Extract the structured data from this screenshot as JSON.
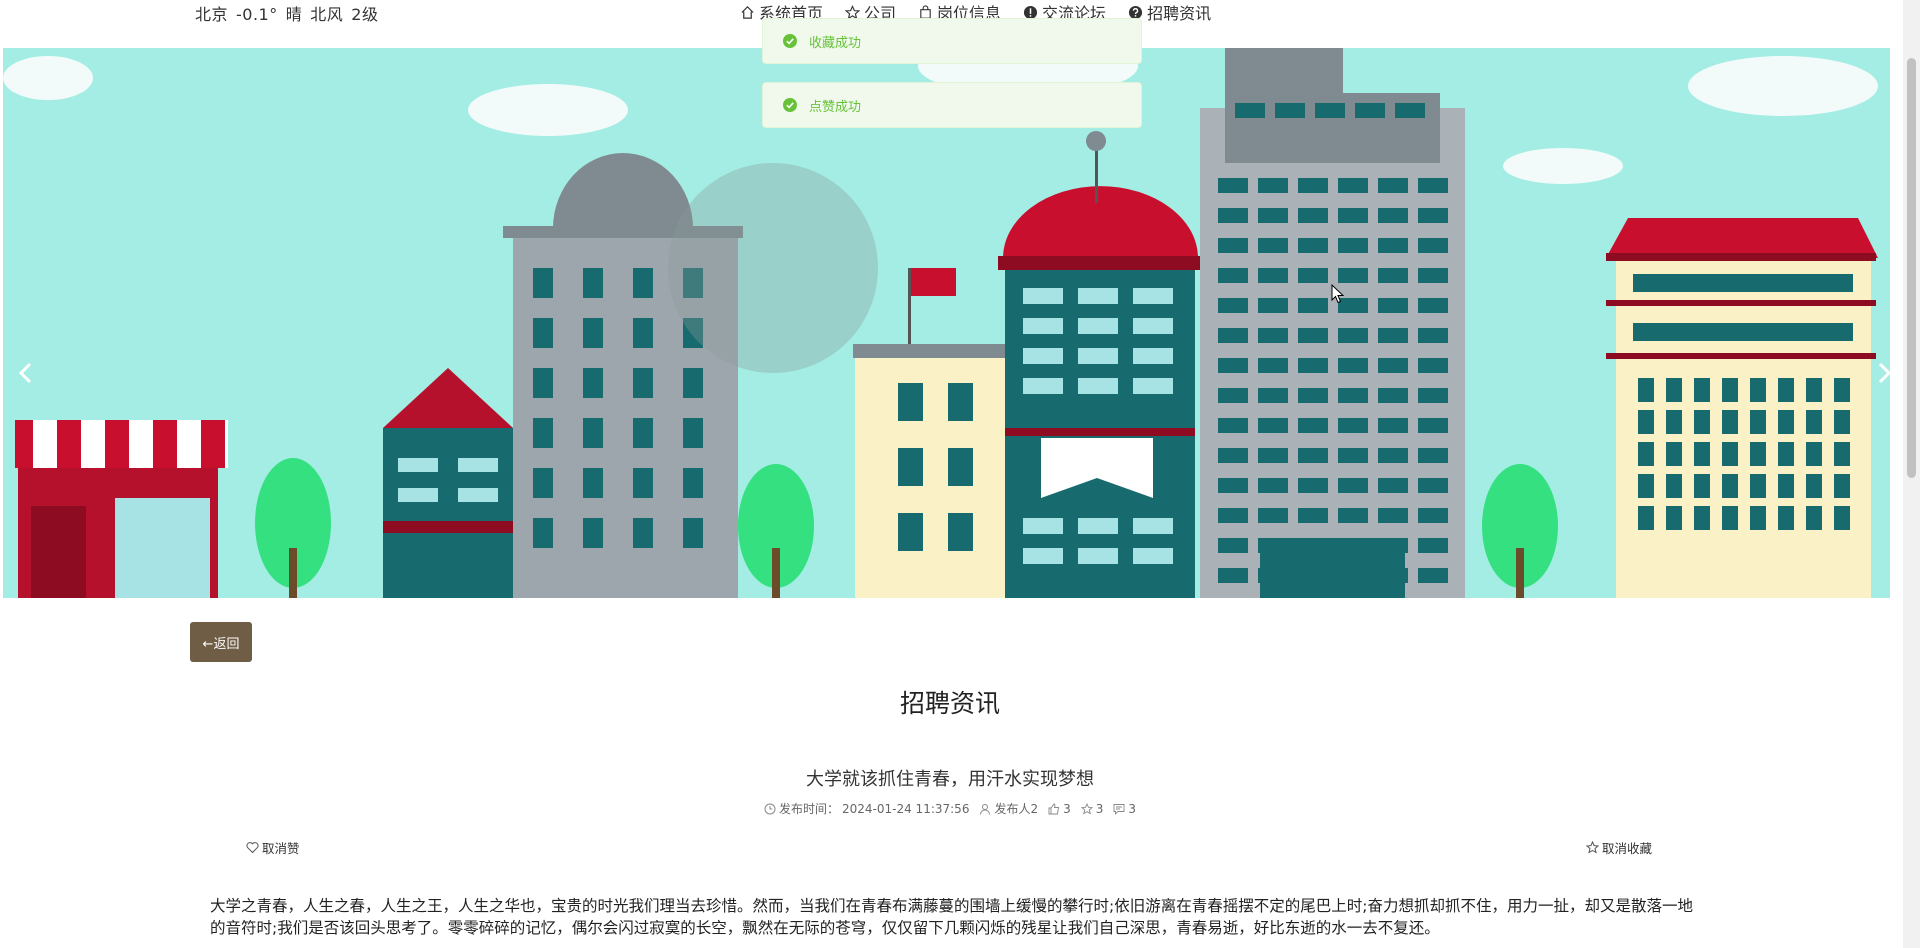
{
  "weather": {
    "city": "北京",
    "temp": "-0.1°",
    "condition": "晴",
    "wind": "北风",
    "level": "2级"
  },
  "nav": [
    {
      "label": "系统首页",
      "icon": "home-icon"
    },
    {
      "label": "公司",
      "icon": "star-icon"
    },
    {
      "label": "岗位信息",
      "icon": "bag-icon"
    },
    {
      "label": "交流论坛",
      "icon": "alert-circle-icon"
    },
    {
      "label": "招聘资讯",
      "icon": "question-circle-icon"
    }
  ],
  "toasts": [
    "收藏成功",
    "点赞成功"
  ],
  "back_label": "←返回",
  "page_title": "招聘资讯",
  "article": {
    "title": "大学就该抓住青春，用汗水实现梦想",
    "publish_label": "发布时间：",
    "publish_time": "2024-01-24 11:37:56",
    "author": "发布人2",
    "likes": "3",
    "stars": "3",
    "comments": "3",
    "unlike_label": "取消赞",
    "uncollect_label": "取消收藏",
    "body": "大学之青春，人生之春，人生之王，人生之华也，宝贵的时光我们理当去珍惜。然而，当我们在青春布满藤蔓的围墙上缓慢的攀行时;依旧游离在青春摇摆不定的尾巴上时;奋力想抓却抓不住，用力一扯，却又是散落一地的音符时;我们是否该回头思考了。零零碎碎的记忆，偶尔会闪过寂寞的长空，飘然在无际的苍穹，仅仅留下几颗闪烁的残星让我们自己深思，青春易逝，好比东逝的水一去不复还。"
  },
  "carousel": {
    "slides": 3,
    "active": 2
  },
  "colors": {
    "toast_text": "#67c23a",
    "toast_bg": "#f0f9eb",
    "back_button": "#6f5d45",
    "banner_sky": "#a4ede4"
  }
}
